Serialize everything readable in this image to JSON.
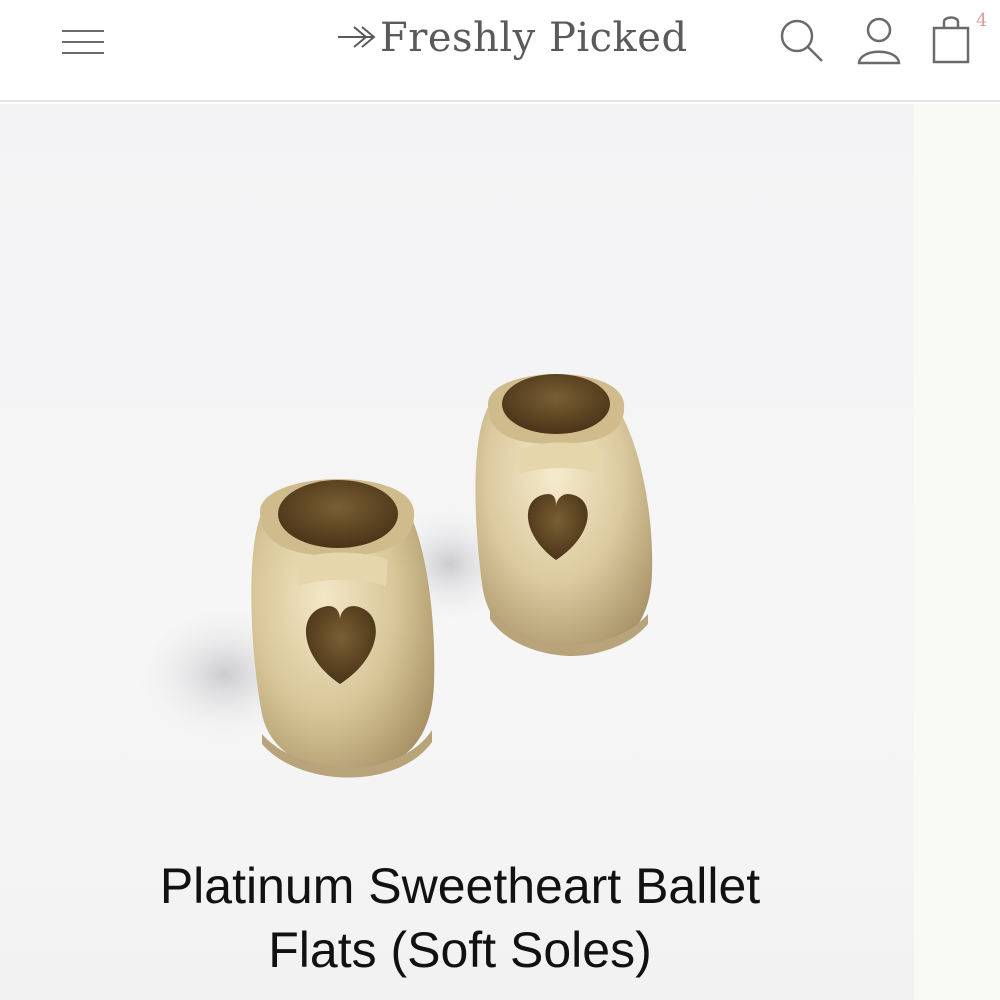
{
  "header": {
    "logo_text": "Freshly Picked",
    "cart_count": "4"
  },
  "icons": {
    "menu": "hamburger-menu-icon",
    "search": "search-icon",
    "account": "user-icon",
    "cart": "shopping-bag-icon",
    "logo_arrow": "arrow-icon"
  },
  "product": {
    "title_line1": "Platinum Sweetheart Ballet",
    "title_line2": "Flats (Soft Soles)"
  },
  "colors": {
    "accent_badge": "#e09a9a",
    "icon_gray": "#6b6b6b",
    "shoe_gold": "#d9c79a"
  }
}
